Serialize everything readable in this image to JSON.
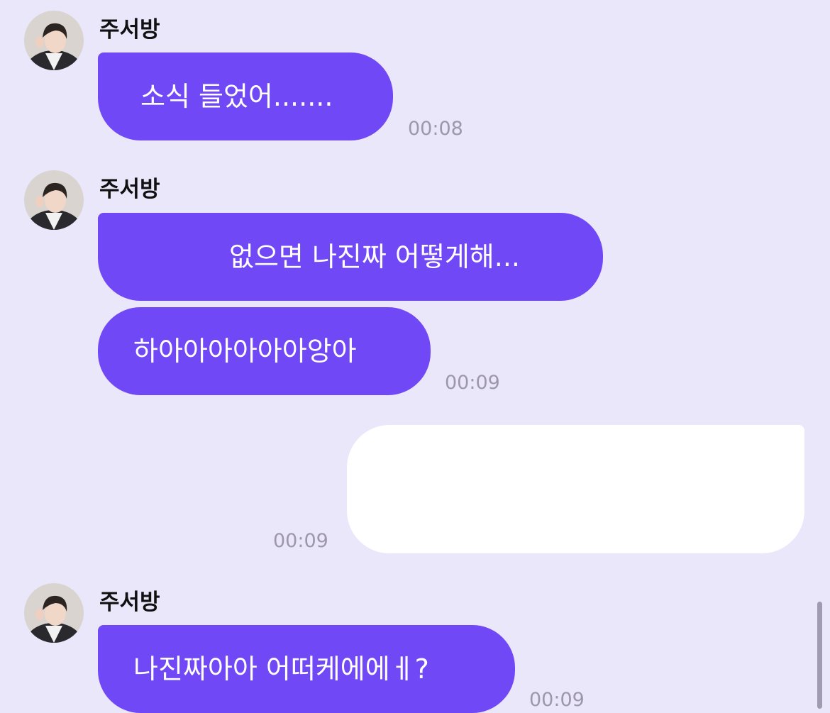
{
  "colors": {
    "background": "#ebe7fb",
    "incoming_bubble": "#7048f6",
    "outgoing_bubble": "#ffffff",
    "timestamp": "#9c97ad"
  },
  "messages": [
    {
      "sender": "주서방",
      "avatar_icon": "profile-photo",
      "bubbles": [
        {
          "text": "소식 들었어.......",
          "time": "00:08"
        }
      ]
    },
    {
      "sender": "주서방",
      "avatar_icon": "profile-photo",
      "bubbles": [
        {
          "text": "없으면 나진짜 어떻게해...",
          "time": ""
        },
        {
          "text": "하아아아아아아앙아",
          "time": "00:09"
        }
      ]
    },
    {
      "outgoing": true,
      "text": "",
      "time": "00:09"
    },
    {
      "sender": "주서방",
      "avatar_icon": "profile-photo",
      "bubbles": [
        {
          "text": "나진짜아아 어떠케에에ㅔ?",
          "time": "00:09"
        }
      ]
    }
  ]
}
